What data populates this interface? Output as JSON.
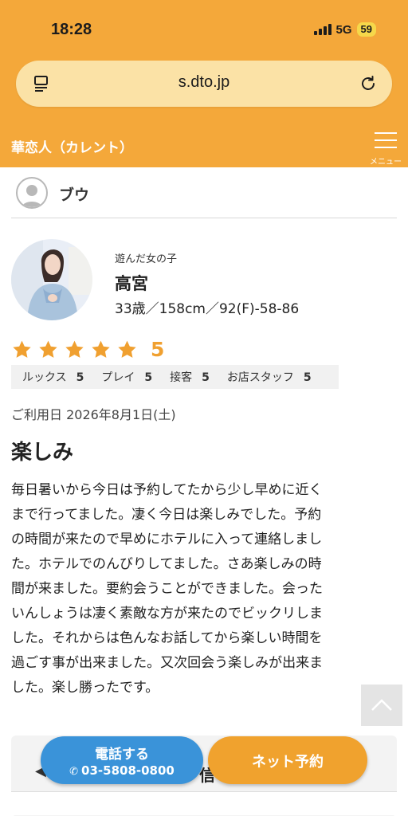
{
  "status_bar": {
    "time": "18:28",
    "network": "5G",
    "battery": "59"
  },
  "browser": {
    "url": "s.dto.jp"
  },
  "header": {
    "site_title": "華恋人（カレント）",
    "menu_label": "メニュー"
  },
  "reviewer": {
    "name": "ブウ"
  },
  "girl": {
    "caption": "遊んだ女の子",
    "name": "高宮",
    "spec": "33歳／158cm／92(F)-58-86"
  },
  "rating": {
    "stars": 5,
    "value": "5"
  },
  "scores": [
    {
      "label": "ルックス",
      "value": "5"
    },
    {
      "label": "プレイ",
      "value": "5"
    },
    {
      "label": "接客",
      "value": "5"
    },
    {
      "label": "お店スタッフ",
      "value": "5"
    }
  ],
  "review": {
    "visit_date": "ご利用日 2026年8月1日(土)",
    "title": "楽しみ",
    "body": "毎日暑いから今日は予約してたから少し早めに近く\nまで行ってました。凄く今日は楽しみでした。予約\nの時間が来たので早めにホテルに入って連絡しまし\nた。ホテルでのんびりしてました。さあ楽しみの時\n間が来ました。要約会うことができました。会った\nいんしょうは凄く素敵な方が来たのでビックリしま\nした。それからは色んなお話してから楽しい時間を\n過ごす事が出来ました。又次回会う楽しみが出来ま\nした。楽し勝ったです。"
  },
  "bottom_panel": {
    "hidden_char": "信"
  },
  "actions": {
    "call_label": "電話する",
    "call_number": "03-5808-0800",
    "web_label": "ネット予約"
  },
  "colors": {
    "header": "#f4a83a",
    "star": "#f0a030",
    "call": "#3a93d9",
    "web": "#f0a22e"
  }
}
